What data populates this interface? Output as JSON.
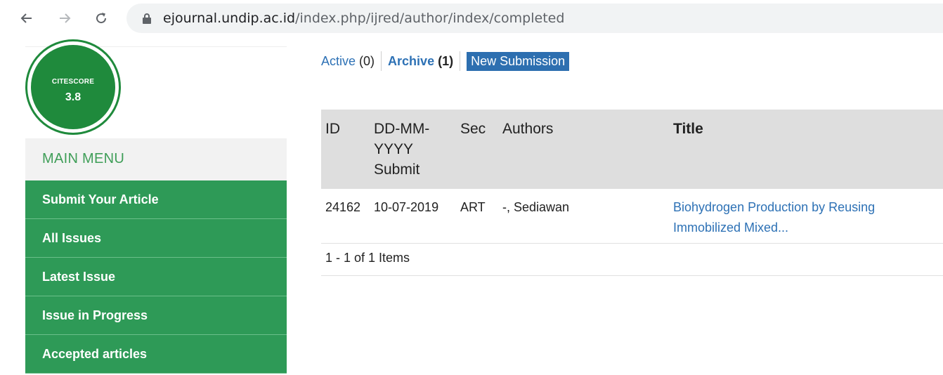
{
  "browser": {
    "url_host": "ejournal.undip.ac.id",
    "url_path": "/index.php/ijred/author/index/completed",
    "back_icon": "arrow-left-icon",
    "forward_icon": "arrow-right-icon",
    "reload_icon": "reload-icon",
    "lock_icon": "lock-icon"
  },
  "badge": {
    "label": "CITESCORE",
    "value": "3.8",
    "color": "#1f8a3c"
  },
  "sidebar": {
    "heading": "MAIN MENU",
    "items": [
      {
        "label": "Submit Your Article"
      },
      {
        "label": "All Issues"
      },
      {
        "label": "Latest Issue"
      },
      {
        "label": "Issue in Progress"
      },
      {
        "label": "Accepted articles"
      }
    ],
    "color": "#2e9a57"
  },
  "tabs": {
    "active_label": "Active",
    "active_count": "(0)",
    "archive_label": "Archive",
    "archive_count": "(1)",
    "new_submission": "New Submission"
  },
  "table": {
    "headers": {
      "id": "ID",
      "date_line1": "DD-MM-",
      "date_line2": "YYYY",
      "date_line3": "Submit",
      "sec": "Sec",
      "authors": "Authors",
      "title": "Title"
    },
    "rows": [
      {
        "id": "24162",
        "date": "10-07-2019",
        "sec": "ART",
        "authors": "-, Sediawan",
        "title_line1": "Biohydrogen Production by Reusing",
        "title_line2": "Immobilized Mixed..."
      }
    ],
    "items_count": "1 - 1 of 1 Items"
  }
}
